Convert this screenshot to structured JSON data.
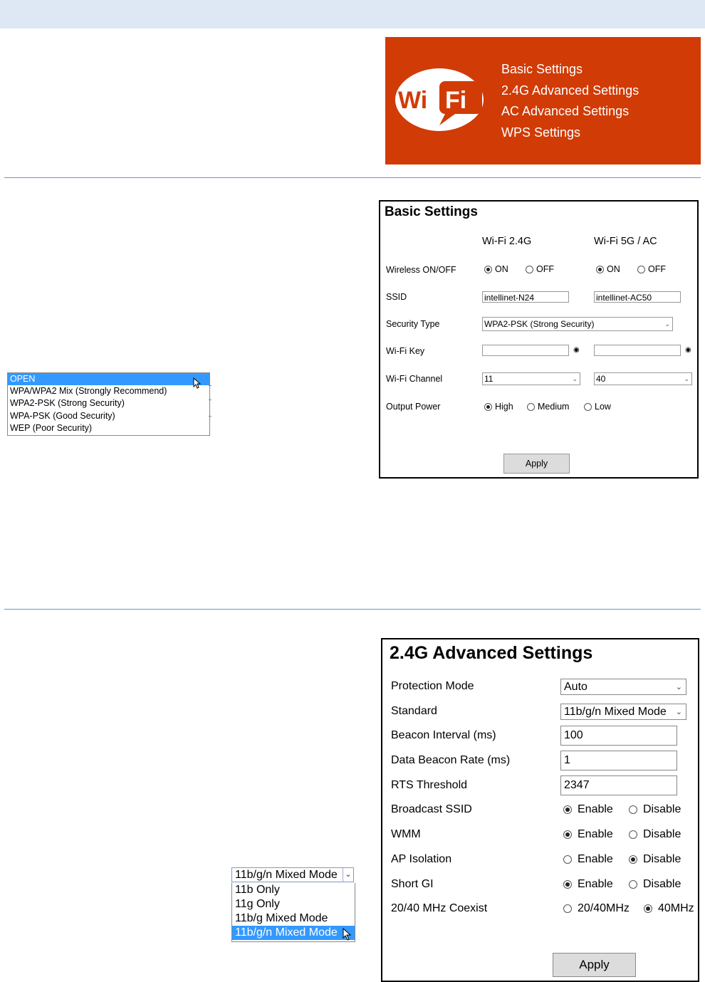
{
  "banner": {
    "logo_text_left": "Wi",
    "logo_text_right": "Fi",
    "menu": [
      "Basic Settings",
      "2.4G Advanced Settings",
      "AC Advanced Settings",
      "WPS Settings"
    ],
    "color": "#d13b06"
  },
  "security_dropdown": {
    "options": [
      "OPEN",
      "WPA/WPA2 Mix (Strongly Recommend)",
      "WPA2-PSK (Strong Security)",
      "WPA-PSK (Good Security)",
      "WEP (Poor Security)"
    ],
    "highlighted": "OPEN"
  },
  "basic": {
    "title": "Basic Settings",
    "col_24": "Wi-Fi 2.4G",
    "col_5g": "Wi-Fi 5G / AC",
    "labels": {
      "wireless": "Wireless ON/OFF",
      "ssid": "SSID",
      "security": "Security Type",
      "key": "Wi-Fi Key",
      "channel": "Wi-Fi Channel",
      "power": "Output Power"
    },
    "on": "ON",
    "off": "OFF",
    "wireless_24": "ON",
    "wireless_5g": "ON",
    "ssid_24": "intellinet-N24",
    "ssid_5g": "intellinet-AC50",
    "security_type": "WPA2-PSK (Strong Security)",
    "key_24": "",
    "key_5g": "",
    "channel_24": "11",
    "channel_5g": "40",
    "power_options": [
      "High",
      "Medium",
      "Low"
    ],
    "power_selected": "High",
    "apply": "Apply"
  },
  "advanced": {
    "title": "2.4G Advanced Settings",
    "labels": {
      "protection": "Protection Mode",
      "standard": "Standard",
      "beacon": "Beacon Interval (ms)",
      "data_beacon": "Data Beacon Rate (ms)",
      "rts": "RTS Threshold",
      "broadcast": "Broadcast SSID",
      "wmm": "WMM",
      "ap_isolation": "AP Isolation",
      "short_gi": "Short GI",
      "coexist": "20/40 MHz Coexist"
    },
    "protection_mode": "Auto",
    "standard": "11b/g/n Mixed Mode",
    "beacon_interval": "100",
    "data_beacon_rate": "1",
    "rts_threshold": "2347",
    "enable": "Enable",
    "disable": "Disable",
    "broadcast_ssid": "Enable",
    "wmm": "Enable",
    "ap_isolation": "Disable",
    "short_gi": "Enable",
    "coexist_opt1": "20/40MHz",
    "coexist_opt2": "40MHz",
    "coexist": "40MHz",
    "apply": "Apply"
  },
  "standard_dropdown": {
    "current": "11b/g/n Mixed Mode",
    "options": [
      "11b Only",
      "11g Only",
      "11b/g Mixed Mode",
      "11b/g/n Mixed Mode"
    ],
    "highlighted": "11b/g/n Mixed Mode"
  }
}
